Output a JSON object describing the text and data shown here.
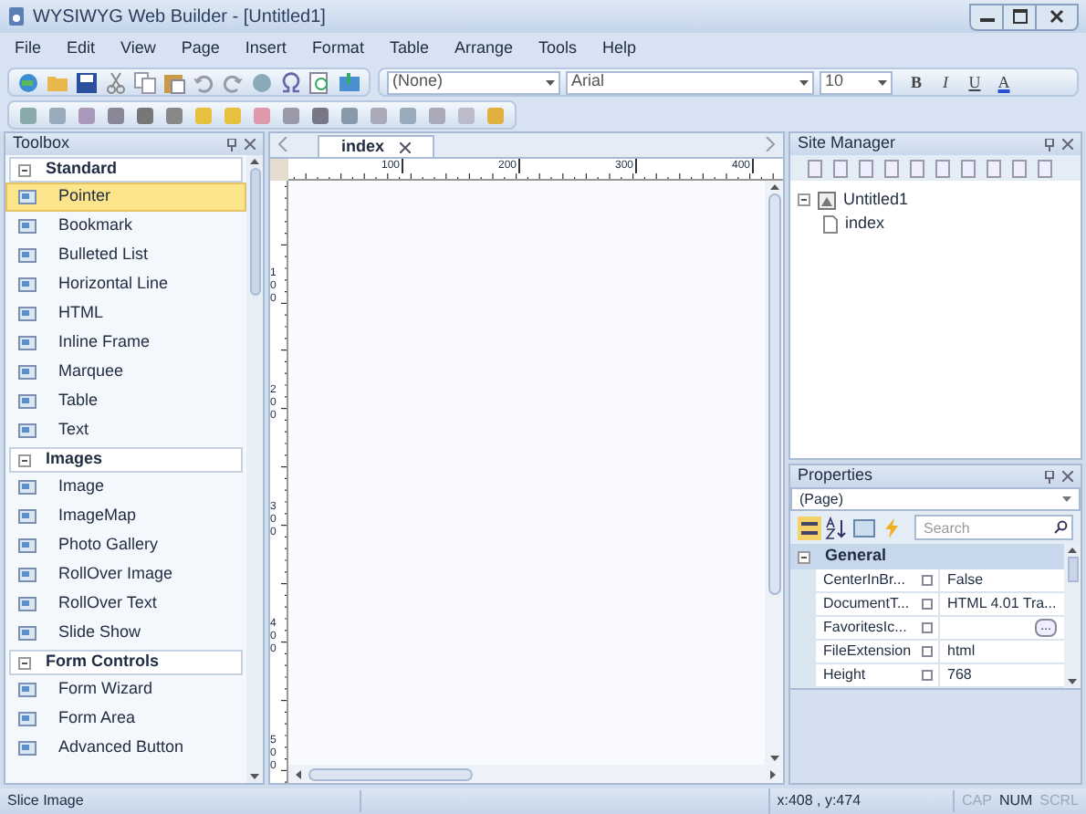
{
  "window": {
    "title": "WYSIWYG Web Builder - [Untitled1]"
  },
  "menu": [
    "File",
    "Edit",
    "View",
    "Page",
    "Insert",
    "Format",
    "Table",
    "Arrange",
    "Tools",
    "Help"
  ],
  "format_bar": {
    "style": "(None)",
    "font": "Arial",
    "size": "10",
    "buttons": [
      "B",
      "I",
      "U",
      "A"
    ]
  },
  "toolbox": {
    "title": "Toolbox",
    "categories": [
      {
        "label": "Standard",
        "expanded": true,
        "items": [
          {
            "label": "Pointer",
            "selected": true
          },
          {
            "label": "Bookmark",
            "selected": false
          },
          {
            "label": "Bulleted List",
            "selected": false
          },
          {
            "label": "Horizontal Line",
            "selected": false
          },
          {
            "label": "HTML",
            "selected": false
          },
          {
            "label": "Inline Frame",
            "selected": false
          },
          {
            "label": "Marquee",
            "selected": false
          },
          {
            "label": "Table",
            "selected": false
          },
          {
            "label": "Text",
            "selected": false
          }
        ]
      },
      {
        "label": "Images",
        "expanded": true,
        "items": [
          {
            "label": "Image",
            "selected": false
          },
          {
            "label": "ImageMap",
            "selected": false
          },
          {
            "label": "Photo Gallery",
            "selected": false
          },
          {
            "label": "RollOver Image",
            "selected": false
          },
          {
            "label": "RollOver Text",
            "selected": false
          },
          {
            "label": "Slide Show",
            "selected": false
          }
        ]
      },
      {
        "label": "Form Controls",
        "expanded": true,
        "items": [
          {
            "label": "Form Wizard",
            "selected": false
          },
          {
            "label": "Form Area",
            "selected": false
          },
          {
            "label": "Advanced Button",
            "selected": false
          }
        ]
      }
    ]
  },
  "tabs": [
    {
      "label": "index",
      "selected": true
    }
  ],
  "ruler": {
    "horizontal": [
      "100",
      "200",
      "300",
      "400"
    ],
    "vertical": [
      "100",
      "200",
      "300",
      "400",
      "500"
    ]
  },
  "site_manager": {
    "title": "Site Manager",
    "tree": [
      {
        "label": "Untitled1",
        "expanded": true,
        "children": [
          {
            "label": "index"
          }
        ]
      }
    ]
  },
  "properties": {
    "title": "Properties",
    "object": "(Page)",
    "search": {
      "placeholder": "Search"
    },
    "category": {
      "label": "General",
      "expanded": true
    },
    "rows": [
      {
        "name": "CenterInBr...",
        "value": "False"
      },
      {
        "name": "DocumentT...",
        "value": "HTML 4.01 Tra..."
      },
      {
        "name": "FavoritesIc...",
        "value": "",
        "browse": "..."
      },
      {
        "name": "FileExtension",
        "value": "html"
      },
      {
        "name": "Height",
        "value": "768"
      }
    ]
  },
  "status_bar": {
    "message": "Slice Image",
    "position": "x:408 , y:474",
    "indicators": [
      {
        "label": "CAP",
        "on": false
      },
      {
        "label": "NUM",
        "on": true
      },
      {
        "label": "SCRL",
        "on": false
      }
    ]
  }
}
